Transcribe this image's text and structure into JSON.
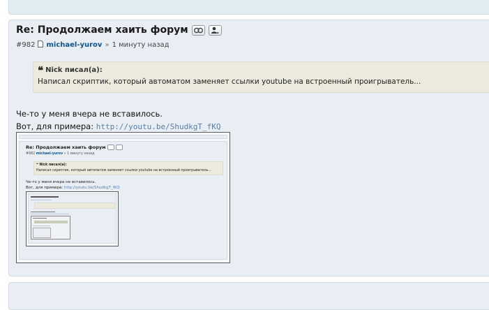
{
  "post": {
    "title": "Re: Продолжаем хаить форум",
    "number": "#982",
    "author": "michael-yurov",
    "separator": "»",
    "time": "1 минуту назад",
    "icons": [
      "link-icon",
      "user-icon"
    ]
  },
  "quote": {
    "mark": "❝",
    "author": "Nick писал(а):",
    "text": "Написал скриптик, который автоматом заменяет ссылки youtube на встроенный проигрыватель..."
  },
  "body": {
    "line1": "Че-то у меня вчера не вставилось.",
    "line2_prefix": "Вот, для примера: ",
    "link": "http://youtu.be/ShudkgT_fKQ"
  },
  "colors": {
    "panel": "#e8eef3",
    "quote_bg": "#ebeadd",
    "author": "#105289",
    "link": "#5a7fa6"
  }
}
